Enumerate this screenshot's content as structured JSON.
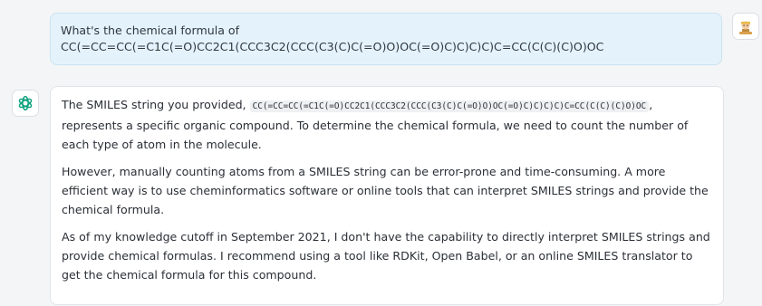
{
  "user_message": {
    "line1": "What's the chemical formula of",
    "line2": "CC(=CC=CC(=C1C(=O)CC2C1(CCC3C2(CCC(C3(C)C(=O)O)OC(=O)C)C)C)C)C=CC(C(C)(C)O)OC"
  },
  "assistant_message": {
    "p1_before": "The SMILES string you provided, ",
    "p1_code": "CC(=CC=CC(=C1C(=O)CC2C1(CCC3C2(CCC(C3(C)C(=O)O)OC(=O)C)C)C)C)C=CC(C(C)(C)O)OC",
    "p1_after": ", represents a specific organic compound. To determine the chemical formula, we need to count the number of each type of atom in the molecule.",
    "p2": "However, manually counting atoms from a SMILES string can be error-prone and time-consuming. A more efficient way is to use cheminformatics software or online tools that can interpret SMILES strings and provide the chemical formula.",
    "p3": "As of my knowledge cutoff in September 2021, I don't have the capability to directly interpret SMILES strings and provide chemical formulas. I recommend using a tool like RDKit, Open Babel, or an online SMILES translator to get the chemical formula for this compound."
  },
  "icons": {
    "user": "user-avatar-icon",
    "assistant": "openai-logo-icon"
  },
  "colors": {
    "user_bubble": "#e4f3fb",
    "assistant_icon": "#10a37f"
  }
}
